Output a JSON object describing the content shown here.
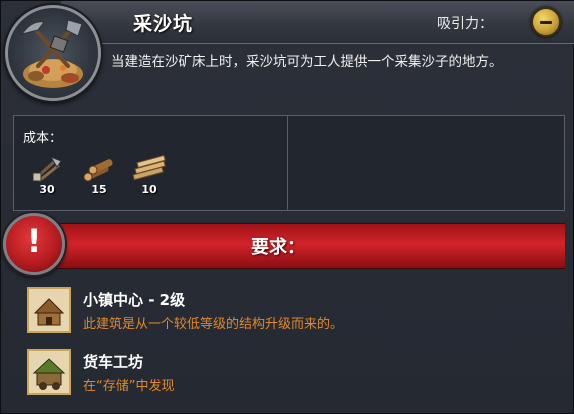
{
  "header": {
    "title": "采沙坑",
    "attract_label": "吸引力："
  },
  "description": "当建造在沙矿床上时，采沙坑可为工人提供一个采集沙子的地方。",
  "cost": {
    "label": "成本：",
    "resources": [
      {
        "icon": "iron-tools-icon",
        "amount": "30"
      },
      {
        "icon": "logs-icon",
        "amount": "15"
      },
      {
        "icon": "planks-icon",
        "amount": "10"
      }
    ]
  },
  "requirements": {
    "label": "要求：",
    "items": [
      {
        "icon": "town-center-icon",
        "title": "小镇中心 - 2级",
        "subtitle": "此建筑是从一个较低等级的结构升级而来的。"
      },
      {
        "icon": "wagon-shop-icon",
        "title": "货车工坊",
        "subtitle": "在“存储”中发现"
      }
    ]
  },
  "colors": {
    "requirement_bar": "#c41e24",
    "subtitle_orange": "#e0882c",
    "attract_gold": "#d9b04a"
  }
}
